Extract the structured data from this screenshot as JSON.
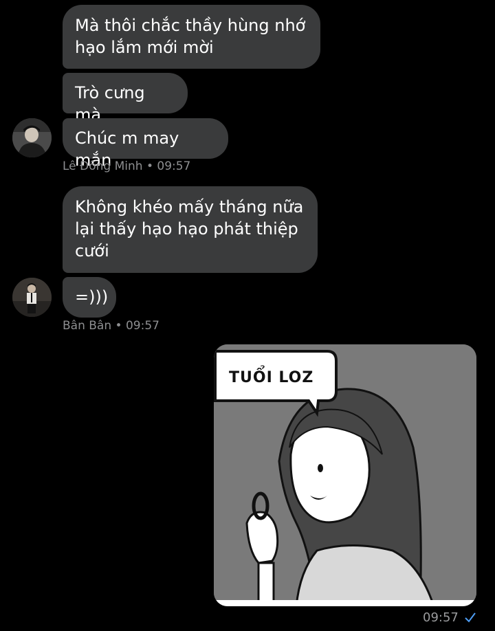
{
  "messages": [
    {
      "text": "Mà thôi chắc thầy hùng nhớ hạo lắm mới mời"
    },
    {
      "text": "Trò cưng mà"
    },
    {
      "text": "Chúc m may mắn"
    },
    {
      "text": "Không khéo mấy tháng nữa lại thấy hạo hạo phát thiệp cưới"
    },
    {
      "text": "=)))"
    }
  ],
  "meta1": {
    "sender": "Lê Đông Minh",
    "time": "09:57"
  },
  "meta2": {
    "sender": "Bân Bân",
    "time": "09:57"
  },
  "sticker": {
    "caption": "TUỔI LOZ",
    "time": "09:57"
  },
  "colors": {
    "background": "#000000",
    "bubble": "#3a3b3c",
    "meta": "#8e8f91",
    "check": "#4e9ef5"
  },
  "icons": [
    "avatar",
    "read-check-icon"
  ]
}
